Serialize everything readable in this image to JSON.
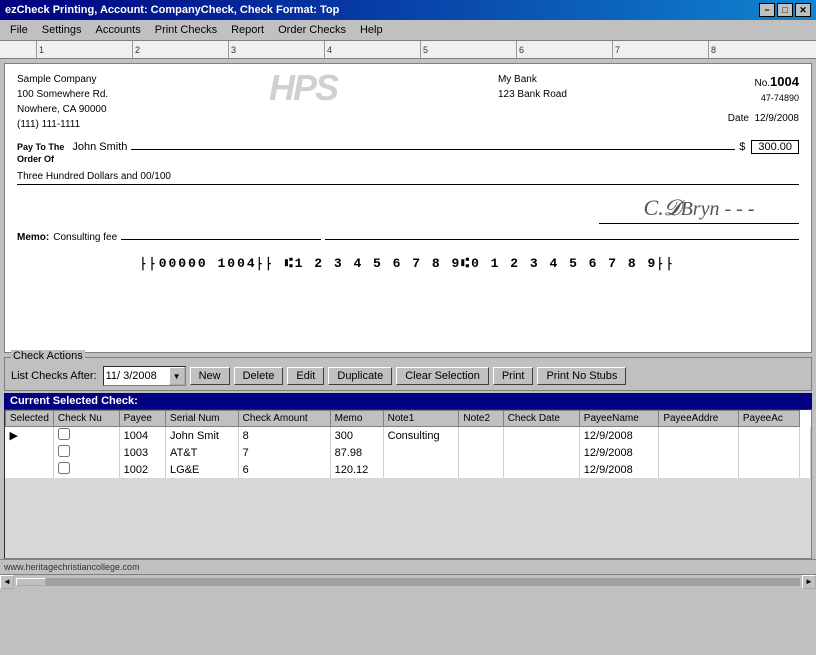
{
  "titleBar": {
    "title": "ezCheck Printing, Account: CompanyCheck, Check Format: Top",
    "buttons": {
      "minimize": "−",
      "maximize": "□",
      "close": "✕"
    }
  },
  "menuBar": {
    "items": [
      "File",
      "Settings",
      "Accounts",
      "Print Checks",
      "Report",
      "Order Checks",
      "Help"
    ]
  },
  "ruler": {
    "marks": [
      "1",
      "2",
      "3",
      "4",
      "5",
      "6",
      "7",
      "8"
    ]
  },
  "check": {
    "companyName": "Sample Company",
    "companyAddress1": "100 Somewhere Rd.",
    "companyAddress2": "Nowhere, CA 90000",
    "companyPhone": "(111) 111-1111",
    "logoText": "HPS",
    "bankName": "My Bank",
    "bankAddress": "123 Bank Road",
    "checkNoLabel": "No.",
    "checkNo": "1004",
    "routingNo": "47-74890",
    "dateLabel": "Date",
    "date": "12/9/2008",
    "payToLabel": "Pay To The\nOrder Of",
    "payeeName": "John Smith",
    "dollarSign": "$",
    "amount": "300.00",
    "amountWords": "Three Hundred  Dollars and 00/100",
    "memoLabel": "Memo:",
    "memoValue": "Consulting fee",
    "micrLine": "\"\"00000 1004\"\" ⑆1 2 3 4 5 6 7 8 9⑆0 1 2 3 4 5 6 7 8 9\"\"",
    "signatureText": "C. Bryn"
  },
  "checkActions": {
    "groupTitle": "Check Actions",
    "listChecksLabel": "List Checks After:",
    "dateValue": "11/ 3/2008",
    "buttons": {
      "new": "New",
      "delete": "Delete",
      "edit": "Edit",
      "duplicate": "Duplicate",
      "clearSelection": "Clear Selection",
      "print": "Print",
      "printNoStubs": "Print No Stubs"
    }
  },
  "currentSelectedLabel": "Current Selected Check:",
  "table": {
    "headers": [
      "Selected",
      "Check Nu",
      "Payee",
      "Serial Num",
      "Check Amount",
      "Memo",
      "Note1",
      "Note2",
      "Check Date",
      "PayeeName",
      "PayeeAddre",
      "PayeeAc"
    ],
    "rows": [
      {
        "selected": false,
        "active": true,
        "checkNo": "1004",
        "payee": "John Smit",
        "serial": "8",
        "amount": "300",
        "memo": "Consulting",
        "note1": "",
        "note2": "",
        "checkDate": "12/9/2008",
        "payeeName": "",
        "payeeAddr": "",
        "payeeAc": ""
      },
      {
        "selected": false,
        "active": false,
        "checkNo": "1003",
        "payee": "AT&T",
        "serial": "7",
        "amount": "87.98",
        "memo": "",
        "note1": "",
        "note2": "",
        "checkDate": "12/9/2008",
        "payeeName": "",
        "payeeAddr": "",
        "payeeAc": ""
      },
      {
        "selected": false,
        "active": false,
        "checkNo": "1002",
        "payee": "LG&E",
        "serial": "6",
        "amount": "120.12",
        "memo": "",
        "note1": "",
        "note2": "",
        "checkDate": "12/9/2008",
        "payeeName": "",
        "payeeAddr": "",
        "payeeAc": ""
      }
    ]
  },
  "footer": {
    "website": "www.heritagechristiancollege.com"
  }
}
